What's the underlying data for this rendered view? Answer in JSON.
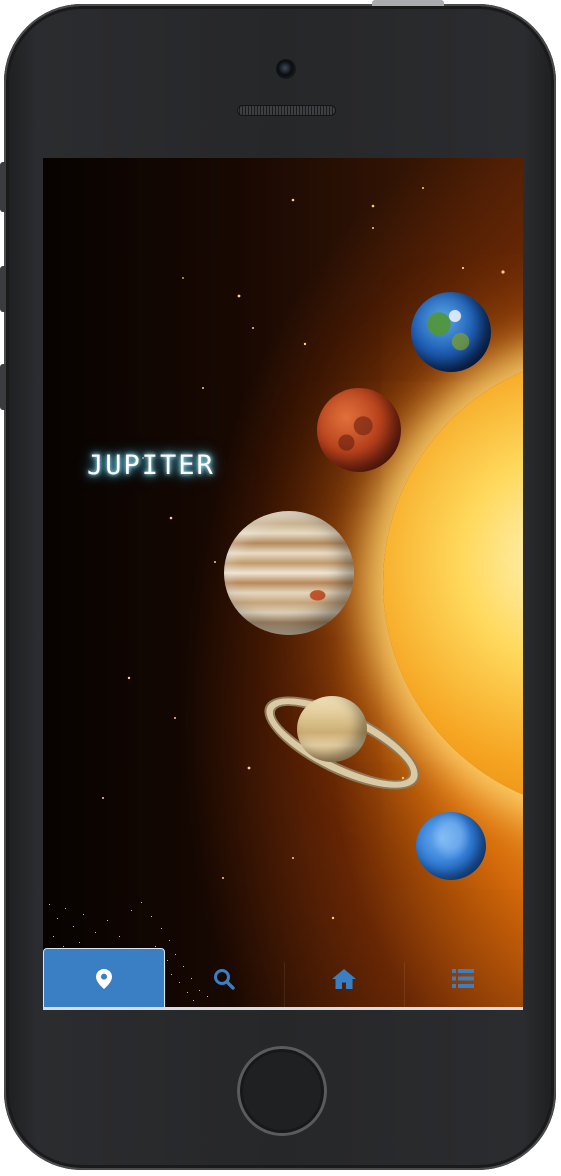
{
  "app": {
    "planet_title": "JUPITER",
    "planets_shown": [
      "earth",
      "mars",
      "jupiter",
      "saturn",
      "neptune"
    ],
    "selected_planet": "jupiter"
  },
  "tabs": [
    {
      "icon": "map-marker-icon",
      "active": true
    },
    {
      "icon": "search-icon",
      "active": false
    },
    {
      "icon": "home-icon",
      "active": false
    },
    {
      "icon": "list-icon",
      "active": false
    }
  ],
  "colors": {
    "tab_active_bg": "#3a7fc3",
    "tab_icon": "#3a7fc3",
    "tab_icon_active": "#ffffff",
    "title_glow": "#5fd7ff",
    "device_body": "#262729"
  }
}
